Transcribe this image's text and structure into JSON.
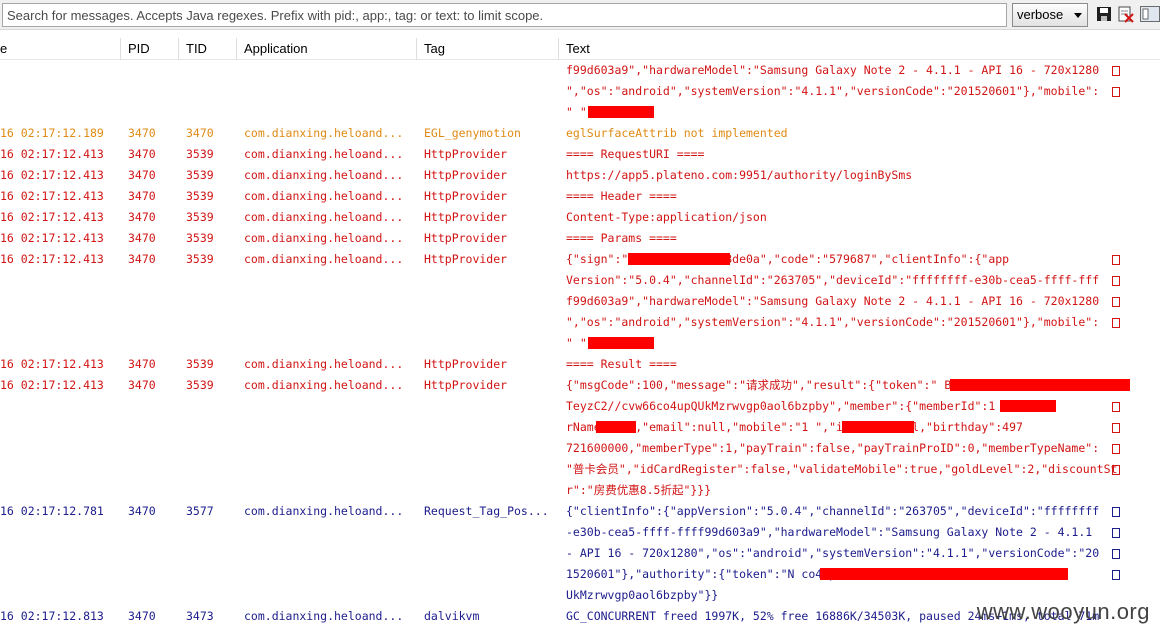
{
  "toolbar": {
    "search_placeholder": "Search for messages. Accepts Java regexes. Prefix with pid:, app:, tag: or text: to limit scope.",
    "level_value": "verbose",
    "icons": [
      "save-icon",
      "clear-log-icon",
      "toggle-columns-icon"
    ]
  },
  "columns": {
    "time": "e",
    "pid": "PID",
    "tid": "TID",
    "application": "Application",
    "tag": "Tag",
    "text": "Text"
  },
  "colors": {
    "info": "#1c1c8c",
    "warn": "#e08a13",
    "error": "#d21414",
    "redaction": "#ff0000"
  },
  "lines": [
    {
      "level": "error",
      "time": "",
      "pid": "",
      "tid": "",
      "app": "",
      "tag": "",
      "text": "f99d603a9\",\"hardwareModel\":\"Samsung Galaxy Note 2 - 4.1.1 - API 16 - 720x1280 "
    },
    {
      "level": "error",
      "time": "",
      "pid": "",
      "tid": "",
      "app": "",
      "tag": "",
      "text": "\",\"os\":\"android\",\"systemVersion\":\"4.1.1\",\"versionCode\":\"201520601\"},\"mobile\": "
    },
    {
      "level": "error",
      "time": "",
      "pid": "",
      "tid": "",
      "app": "",
      "tag": "",
      "text": "\"           \"}"
    },
    {
      "level": "warn",
      "time": "16 02:17:12.189",
      "pid": "3470",
      "tid": "3470",
      "app": "com.dianxing.heloand...",
      "tag": "EGL_genymotion",
      "text": "eglSurfaceAttrib not implemented"
    },
    {
      "level": "error",
      "time": "16 02:17:12.413",
      "pid": "3470",
      "tid": "3539",
      "app": "com.dianxing.heloand...",
      "tag": "HttpProvider",
      "text": "==== RequestURI ===="
    },
    {
      "level": "error",
      "time": "16 02:17:12.413",
      "pid": "3470",
      "tid": "3539",
      "app": "com.dianxing.heloand...",
      "tag": "HttpProvider",
      "text": "https://app5.plateno.com:9951/authority/loginBySms"
    },
    {
      "level": "error",
      "time": "16 02:17:12.413",
      "pid": "3470",
      "tid": "3539",
      "app": "com.dianxing.heloand...",
      "tag": "HttpProvider",
      "text": "==== Header ===="
    },
    {
      "level": "error",
      "time": "16 02:17:12.413",
      "pid": "3470",
      "tid": "3539",
      "app": "com.dianxing.heloand...",
      "tag": "HttpProvider",
      "text": "Content-Type:application/json"
    },
    {
      "level": "error",
      "time": "16 02:17:12.413",
      "pid": "3470",
      "tid": "3539",
      "app": "com.dianxing.heloand...",
      "tag": "HttpProvider",
      "text": "==== Params ===="
    },
    {
      "level": "error",
      "time": "16 02:17:12.413",
      "pid": "3470",
      "tid": "3539",
      "app": "com.dianxing.heloand...",
      "tag": "HttpProvider",
      "text": "{\"sign\":\"                277390e18009a8de0a\",\"code\":\"579687\",\"clientInfo\":{\"app "
    },
    {
      "level": "error",
      "time": "",
      "pid": "",
      "tid": "",
      "app": "",
      "tag": "",
      "text": "Version\":\"5.0.4\",\"channelId\":\"263705\",\"deviceId\":\"ffffffff-e30b-cea5-ffff-fff "
    },
    {
      "level": "error",
      "time": "",
      "pid": "",
      "tid": "",
      "app": "",
      "tag": "",
      "text": "f99d603a9\",\"hardwareModel\":\"Samsung Galaxy Note 2 - 4.1.1 - API 16 - 720x1280 "
    },
    {
      "level": "error",
      "time": "",
      "pid": "",
      "tid": "",
      "app": "",
      "tag": "",
      "text": "\",\"os\":\"android\",\"systemVersion\":\"4.1.1\",\"versionCode\":\"201520601\"},\"mobile\": "
    },
    {
      "level": "error",
      "time": "",
      "pid": "",
      "tid": "",
      "app": "",
      "tag": "",
      "text": "\"           \"}"
    },
    {
      "level": "error",
      "time": "16 02:17:12.413",
      "pid": "3470",
      "tid": "3539",
      "app": "com.dianxing.heloand...",
      "tag": "HttpProvider",
      "text": "==== Result ===="
    },
    {
      "level": "error",
      "time": "16 02:17:12.413",
      "pid": "3470",
      "tid": "3539",
      "app": "com.dianxing.heloand...",
      "tag": "HttpProvider",
      "text": "{\"msgCode\":100,\"message\":\"请求成功\",\"result\":{\"token\":\"                         B "
    },
    {
      "level": "error",
      "time": "",
      "pid": "",
      "tid": "",
      "app": "",
      "tag": "",
      "text": "TeyzC2//cvw66co4upQUkMzrwvgp0aol6bzpby\",\"member\":{\"memberId\":1         ,\"membe "
    },
    {
      "level": "error",
      "time": "",
      "pid": "",
      "tid": "",
      "app": "",
      "tag": "",
      "text": "rName\":\"        \",\"email\":null,\"mobile\":\"1           \",\"isMale\":null,\"birthday\":497 "
    },
    {
      "level": "error",
      "time": "",
      "pid": "",
      "tid": "",
      "app": "",
      "tag": "",
      "text": "721600000,\"memberType\":1,\"payTrain\":false,\"payTrainProID\":0,\"memberTypeName\": "
    },
    {
      "level": "error",
      "time": "",
      "pid": "",
      "tid": "",
      "app": "",
      "tag": "",
      "text": "\"普卡会员\",\"idCardRegister\":false,\"validateMobile\":true,\"goldLevel\":2,\"discountSt "
    },
    {
      "level": "error",
      "time": "",
      "pid": "",
      "tid": "",
      "app": "",
      "tag": "",
      "text": "r\":\"房费优惠8.5折起\"}}}"
    },
    {
      "level": "info",
      "time": "16 02:17:12.781",
      "pid": "3470",
      "tid": "3577",
      "app": "com.dianxing.heloand...",
      "tag": "Request_Tag_Pos...",
      "text": "{\"clientInfo\":{\"appVersion\":\"5.0.4\",\"channelId\":\"263705\",\"deviceId\":\"ffffffff "
    },
    {
      "level": "info",
      "time": "",
      "pid": "",
      "tid": "",
      "app": "",
      "tag": "",
      "text": "-e30b-cea5-ffff-ffff99d603a9\",\"hardwareModel\":\"Samsung Galaxy Note 2 - 4.1.1 "
    },
    {
      "level": "info",
      "time": "",
      "pid": "",
      "tid": "",
      "app": "",
      "tag": "",
      "text": "- API 16 - 720x1280\",\"os\":\"android\",\"systemVersion\":\"4.1.1\",\"versionCode\":\"20 "
    },
    {
      "level": "info",
      "time": "",
      "pid": "",
      "tid": "",
      "app": "",
      "tag": "",
      "text": "1520601\"},\"authority\":{\"token\":\"N                                      co4upQ "
    },
    {
      "level": "info",
      "time": "",
      "pid": "",
      "tid": "",
      "app": "",
      "tag": "",
      "text": "UkMzrwvgp0aol6bzpby\"}}"
    },
    {
      "level": "info",
      "time": "16 02:17:12.813",
      "pid": "3470",
      "tid": "3473",
      "app": "com.dianxing.heloand...",
      "tag": "dalvikvm",
      "text": "GC_CONCURRENT freed 1997K, 52% free 16886K/34503K, paused 24ms+1ms, total 71m"
    }
  ],
  "watermark": "www.wooyun.org"
}
